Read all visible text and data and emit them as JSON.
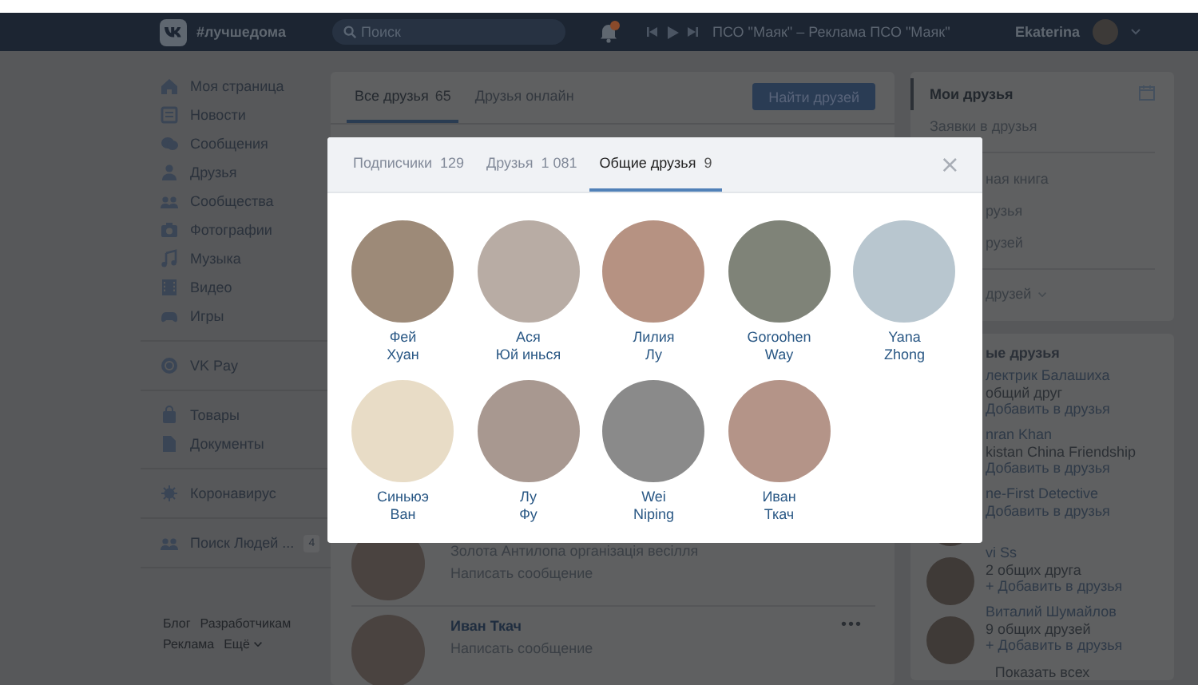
{
  "header": {
    "logo_text": "#лучшедома",
    "search": {
      "placeholder": "Поиск"
    },
    "player_track": "ПСО \"Маяк\" – Реклама ПСО \"Маяк\"",
    "user_name": "Ekaterina"
  },
  "sidebar": {
    "groups": [
      {
        "items": [
          {
            "label": "Моя страница"
          },
          {
            "label": "Новости"
          },
          {
            "label": "Сообщения"
          },
          {
            "label": "Друзья"
          },
          {
            "label": "Сообщества"
          },
          {
            "label": "Фотографии"
          },
          {
            "label": "Музыка"
          },
          {
            "label": "Видео"
          },
          {
            "label": "Игры"
          }
        ]
      },
      {
        "items": [
          {
            "label": "VK Pay"
          }
        ]
      },
      {
        "items": [
          {
            "label": "Товары"
          },
          {
            "label": "Документы"
          }
        ]
      },
      {
        "items": [
          {
            "label": "Коронавирус"
          }
        ]
      },
      {
        "items": [
          {
            "label": "Поиск Людей ...",
            "badge": "4"
          }
        ]
      }
    ],
    "footer_links": [
      "Блог",
      "Разработчикам",
      "Реклама",
      "Ещё"
    ]
  },
  "main": {
    "tabs": [
      {
        "label": "Все друзья",
        "count": "65",
        "selected": true
      },
      {
        "label": "Друзья онлайн",
        "selected": false
      }
    ],
    "find_button": "Найти друзей",
    "friends": [
      {
        "subtitle": "Золота Антилопа організація весілля",
        "action": "Написать сообщение"
      },
      {
        "name": "Иван Ткач",
        "action": "Написать сообщение",
        "menu": "•••"
      }
    ]
  },
  "right": {
    "menu": [
      {
        "label": "Мои друзья",
        "selected": true
      },
      {
        "label": "Заявки в друзья",
        "selected": false
      }
    ],
    "menu_partly_hidden": [
      "ная книга",
      "рузья",
      "рузей"
    ],
    "list_toggle": "друзей",
    "suggestions_title": "ые друзья",
    "suggestions": [
      {
        "name": "лектрик Балашиха",
        "info": "общий друг",
        "action": "Добавить в друзья"
      },
      {
        "name": "nran Khan",
        "info": "kistan China Friendship",
        "action": "Добавить в друзья"
      },
      {
        "name": "ne-First Detective",
        "action": "Добавить в друзья"
      },
      {
        "name": "vi Ss",
        "info": "2 общих друга",
        "action": "+ Добавить в друзья"
      },
      {
        "name": "Виталий Шумайлов",
        "info": "9 общих друзей",
        "action": "+ Добавить в друзья"
      }
    ],
    "show_all": "Показать всех"
  },
  "modal": {
    "tabs": [
      {
        "label": "Подписчики",
        "count": "129",
        "selected": false
      },
      {
        "label": "Друзья",
        "count": "1 081",
        "selected": false
      },
      {
        "label": "Общие друзья",
        "count": "9",
        "selected": true
      }
    ],
    "close": "×",
    "people": [
      {
        "first": "Фей",
        "last": "Хуан"
      },
      {
        "first": "Ася",
        "last": "Юй инься"
      },
      {
        "first": "Лилия",
        "last": "Лу"
      },
      {
        "first": "Goroohen",
        "last": "Way"
      },
      {
        "first": "Yana",
        "last": "Zhong"
      },
      {
        "first": "Синьюэ",
        "last": "Ван"
      },
      {
        "first": "Лу",
        "last": "Фу"
      },
      {
        "first": "Wei",
        "last": "Niping"
      },
      {
        "first": "Иван",
        "last": "Ткач"
      }
    ]
  }
}
